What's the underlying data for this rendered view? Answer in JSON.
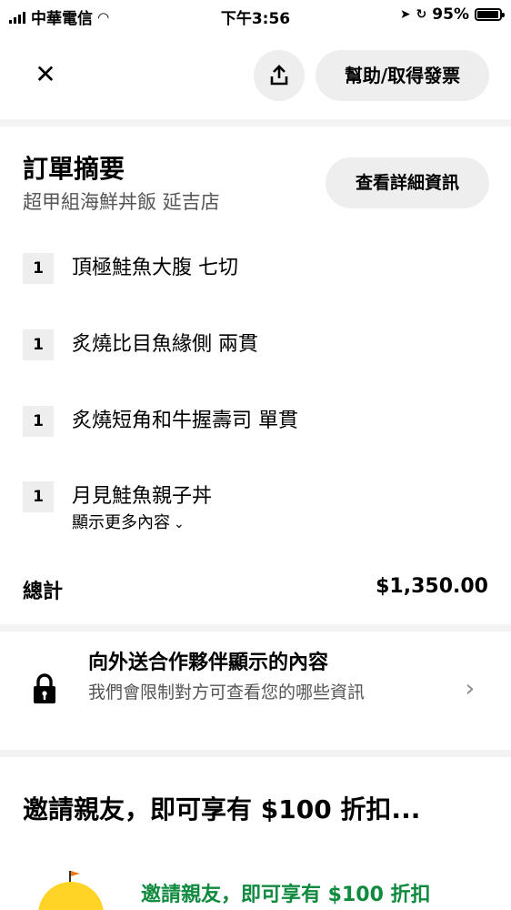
{
  "status_bar": {
    "carrier": "中華電信",
    "time": "下午3:56",
    "battery": "95%",
    "battery_level": 0.95
  },
  "header": {
    "close_icon": "close-icon",
    "share_icon": "share-icon",
    "help_label": "幫助/取得發票"
  },
  "summary": {
    "title": "訂單摘要",
    "store": "超甲組海鮮丼飯 延吉店",
    "details_label": "查看詳細資訊",
    "items": [
      {
        "qty": "1",
        "name": "頂極鮭魚大腹 七切"
      },
      {
        "qty": "1",
        "name": "炙燒比目魚緣側 兩貫"
      },
      {
        "qty": "1",
        "name": "炙燒短角和牛握壽司 單貫"
      },
      {
        "qty": "1",
        "name": "月見鮭魚親子丼"
      }
    ],
    "show_more": "顯示更多內容",
    "total_label": "總計",
    "total_value": "$1,350.00"
  },
  "privacy": {
    "title": "向外送合作夥伴顯示的內容",
    "description": "我們會限制對方可查看您的哪些資訊",
    "icon": "lock-icon"
  },
  "referral": {
    "heading": "邀請親友，即可享有 $100 折扣...",
    "link_label": "邀請親友，即可享有 $100 折扣",
    "accent_color": "#0f8a3f"
  }
}
